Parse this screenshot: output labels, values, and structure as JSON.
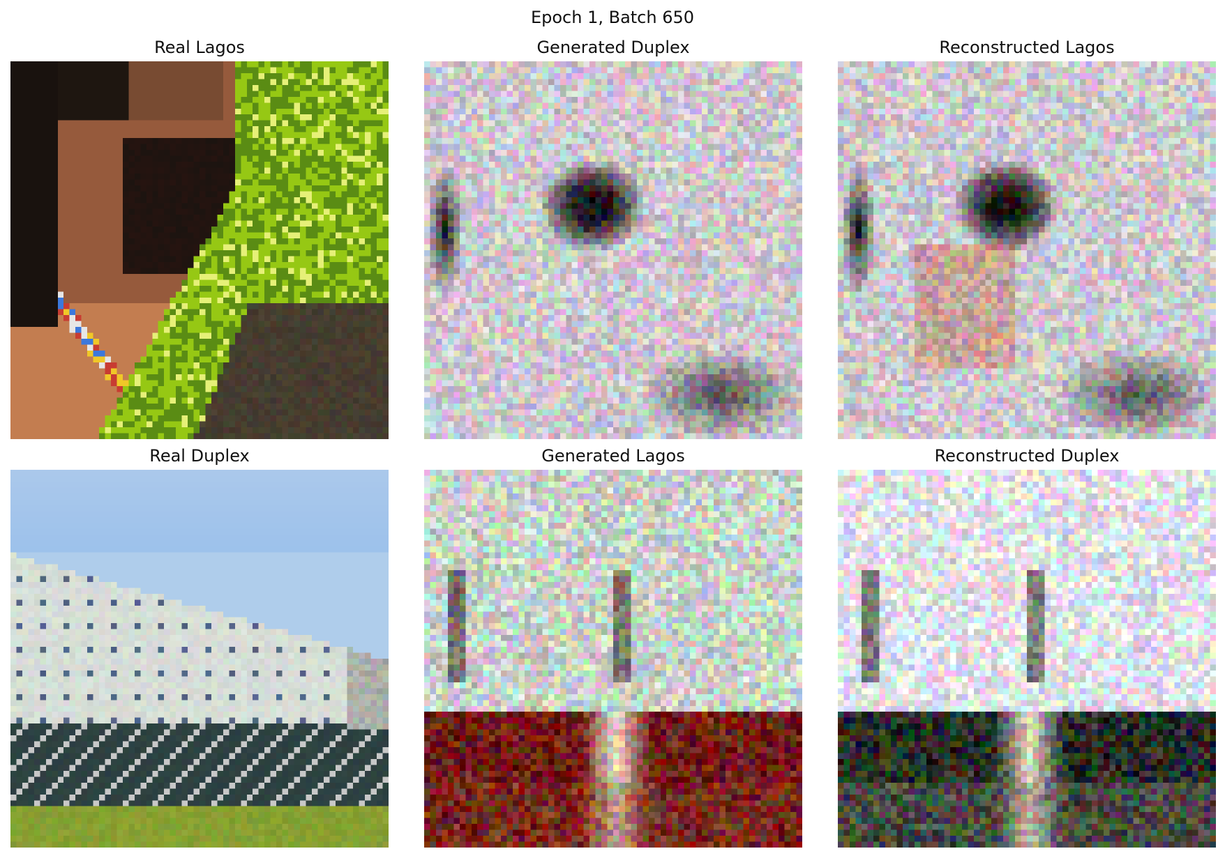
{
  "figure": {
    "suptitle": "Epoch 1, Batch 650"
  },
  "panels": [
    {
      "title": "Real Lagos",
      "scene": "portrait"
    },
    {
      "title": "Generated Duplex",
      "scene": "portrait-gen"
    },
    {
      "title": "Reconstructed Lagos",
      "scene": "portrait-rec"
    },
    {
      "title": "Real Duplex",
      "scene": "building"
    },
    {
      "title": "Generated Lagos",
      "scene": "building-gen"
    },
    {
      "title": "Reconstructed Duplex",
      "scene": "building-rec"
    }
  ]
}
